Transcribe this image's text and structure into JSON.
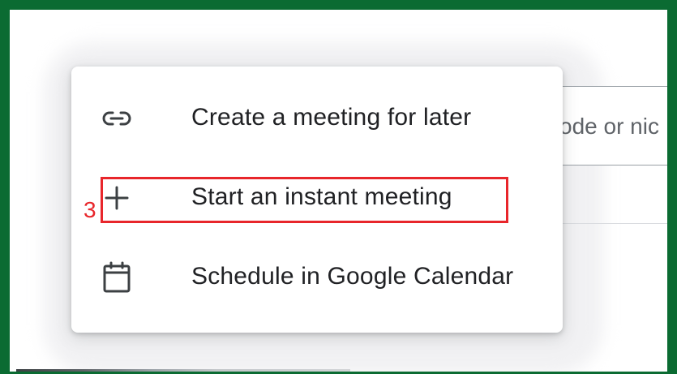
{
  "background": {
    "join_input_placeholder": "ode or nic"
  },
  "menu": {
    "items": [
      {
        "label": "Create a meeting for later",
        "icon": "link-icon"
      },
      {
        "label": "Start an instant meeting",
        "icon": "plus-icon"
      },
      {
        "label": "Schedule in Google Calendar",
        "icon": "calendar-icon"
      }
    ]
  },
  "annotation": {
    "step_number": "3",
    "highlight_color": "#e8262b"
  },
  "colors": {
    "frame": "#0b6b32",
    "text": "#202124",
    "icon": "#3c4043"
  }
}
